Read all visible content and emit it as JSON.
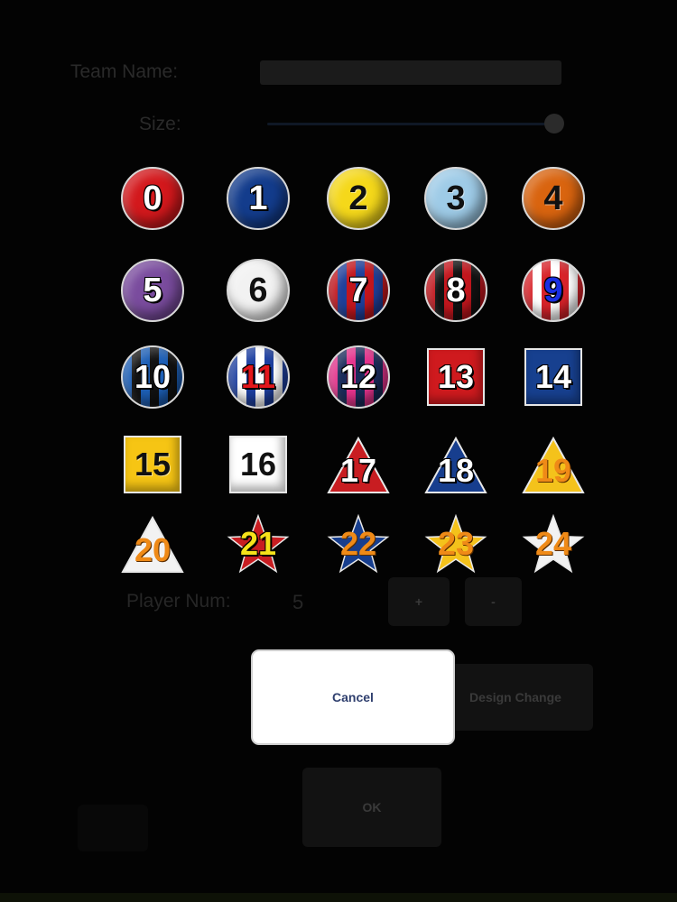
{
  "form": {
    "team_name_label": "Team Name:",
    "team_name_value": "",
    "size_label": "Size:",
    "size_slider_value": 1.0,
    "player_num_label": "Player Num:",
    "player_num_value": "5",
    "plus_label": "+",
    "minus_label": "-",
    "design_change_label": "Design Change",
    "ok_label": "OK"
  },
  "dialog": {
    "cancel_label": "Cancel"
  },
  "icons": [
    {
      "label": "0",
      "shape": "ball",
      "style": "solid",
      "color": "#d3181c",
      "text_color": "#ffffff"
    },
    {
      "label": "1",
      "shape": "ball",
      "style": "solid",
      "color": "#133c8c",
      "text_color": "#ffffff"
    },
    {
      "label": "2",
      "shape": "ball",
      "style": "solid",
      "color": "#f5d81a",
      "text_color": "#111111"
    },
    {
      "label": "3",
      "shape": "ball",
      "style": "solid",
      "color": "#9ecbe7",
      "text_color": "#111111"
    },
    {
      "label": "4",
      "shape": "ball",
      "style": "solid",
      "color": "#d9640f",
      "text_color": "#111111"
    },
    {
      "label": "5",
      "shape": "ball",
      "style": "solid",
      "color": "#7a4c9e",
      "text_color": "#ffffff"
    },
    {
      "label": "6",
      "shape": "ball",
      "style": "solid",
      "color": "#f2f2f2",
      "text_color": "#111111"
    },
    {
      "label": "7",
      "shape": "ball",
      "style": "stripes",
      "colors": [
        "#c3161d",
        "#1f3f9a"
      ],
      "text_color": "#ffffff"
    },
    {
      "label": "8",
      "shape": "ball",
      "style": "stripes",
      "colors": [
        "#c3161d",
        "#111111"
      ],
      "text_color": "#ffffff"
    },
    {
      "label": "9",
      "shape": "ball",
      "style": "stripes",
      "colors": [
        "#d8232a",
        "#ffffff"
      ],
      "text_color": "#1a2fe2"
    },
    {
      "label": "10",
      "shape": "ball",
      "style": "stripes",
      "colors": [
        "#1d5fb6",
        "#111111"
      ],
      "text_color": "#ffffff"
    },
    {
      "label": "11",
      "shape": "ball",
      "style": "stripes",
      "colors": [
        "#1d3fa0",
        "#ffffff"
      ],
      "text_color": "#e4161b"
    },
    {
      "label": "12",
      "shape": "ball",
      "style": "stripes",
      "colors": [
        "#e5338c",
        "#1a2a5a"
      ],
      "text_color": "#ffffff"
    },
    {
      "label": "13",
      "shape": "square",
      "style": "solid",
      "color": "#cf1a1e",
      "text_color": "#ffffff"
    },
    {
      "label": "14",
      "shape": "square",
      "style": "solid",
      "color": "#17408f",
      "text_color": "#ffffff"
    },
    {
      "label": "15",
      "shape": "square",
      "style": "solid",
      "color": "#f6c514",
      "text_color": "#111111"
    },
    {
      "label": "16",
      "shape": "square",
      "style": "solid",
      "color": "#ffffff",
      "text_color": "#111111"
    },
    {
      "label": "17",
      "shape": "triangle",
      "style": "solid",
      "color": "#c81d21",
      "text_color": "#ffffff"
    },
    {
      "label": "18",
      "shape": "triangle",
      "style": "solid",
      "color": "#173e8e",
      "text_color": "#ffffff"
    },
    {
      "label": "19",
      "shape": "triangle",
      "style": "solid",
      "color": "#f4c21b",
      "text_color": "#ef8a17"
    },
    {
      "label": "20",
      "shape": "triangle",
      "style": "solid",
      "color": "#f2f2f2",
      "text_color": "#ef8a17"
    },
    {
      "label": "21",
      "shape": "star",
      "style": "solid",
      "color": "#c81d21",
      "text_color": "#f6e21a"
    },
    {
      "label": "22",
      "shape": "star",
      "style": "solid",
      "color": "#173e8e",
      "text_color": "#ef8a17"
    },
    {
      "label": "23",
      "shape": "star",
      "style": "solid",
      "color": "#f4c21b",
      "text_color": "#ef8a17"
    },
    {
      "label": "24",
      "shape": "star",
      "style": "solid",
      "color": "#f2f2f2",
      "text_color": "#ef8a17"
    }
  ]
}
